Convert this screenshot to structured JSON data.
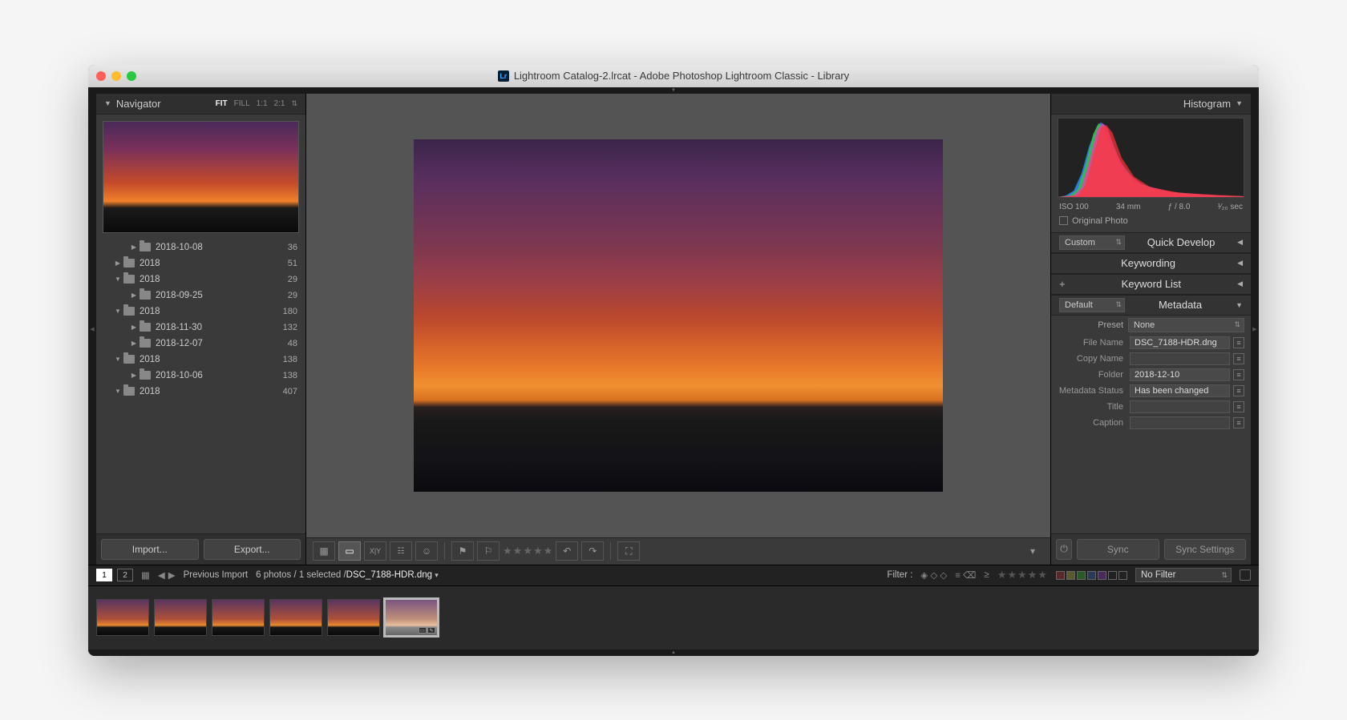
{
  "window": {
    "title": "Lightroom Catalog-2.lrcat - Adobe Photoshop Lightroom Classic - Library"
  },
  "navigator": {
    "title": "Navigator",
    "zoom": [
      "FIT",
      "FILL",
      "1:1",
      "2:1"
    ],
    "zoom_active": "FIT"
  },
  "folders": [
    {
      "indent": 2,
      "tw": "▶",
      "name": "2018-10-08",
      "count": 36
    },
    {
      "indent": 1,
      "tw": "▶",
      "name": "2018",
      "count": 51
    },
    {
      "indent": 1,
      "tw": "▼",
      "name": "2018",
      "count": 29
    },
    {
      "indent": 2,
      "tw": "▶",
      "name": "2018-09-25",
      "count": 29
    },
    {
      "indent": 1,
      "tw": "▼",
      "name": "2018",
      "count": 180
    },
    {
      "indent": 2,
      "tw": "▶",
      "name": "2018-11-30",
      "count": 132
    },
    {
      "indent": 2,
      "tw": "▶",
      "name": "2018-12-07",
      "count": 48
    },
    {
      "indent": 1,
      "tw": "▼",
      "name": "2018",
      "count": 138
    },
    {
      "indent": 2,
      "tw": "▶",
      "name": "2018-10-06",
      "count": 138
    },
    {
      "indent": 1,
      "tw": "▼",
      "name": "2018",
      "count": 407
    }
  ],
  "left_buttons": {
    "import": "Import...",
    "export": "Export..."
  },
  "histogram": {
    "title": "Histogram",
    "iso": "ISO 100",
    "focal": "34 mm",
    "aperture": "ƒ / 8.0",
    "shutter": "¹⁄₂₀ sec",
    "original_label": "Original Photo"
  },
  "quick_develop": {
    "title": "Quick Develop",
    "preset": "Custom"
  },
  "keywording": {
    "title": "Keywording"
  },
  "keyword_list": {
    "title": "Keyword List",
    "plus": "+"
  },
  "metadata": {
    "title": "Metadata",
    "set": "Default",
    "preset_label": "Preset",
    "preset": "None",
    "rows": [
      {
        "label": "File Name",
        "value": "DSC_7188-HDR.dng"
      },
      {
        "label": "Copy Name",
        "value": ""
      },
      {
        "label": "Folder",
        "value": "2018-12-10"
      },
      {
        "label": "Metadata Status",
        "value": "Has been changed"
      },
      {
        "label": "Title",
        "value": ""
      },
      {
        "label": "Caption",
        "value": ""
      }
    ]
  },
  "sync": {
    "sync": "Sync",
    "settings": "Sync Settings"
  },
  "filterbar": {
    "pages": [
      "1",
      "2"
    ],
    "source_label": "Previous Import",
    "count_text": "6 photos / 1 selected /",
    "filename": "DSC_7188-HDR.dng",
    "filter_label": "Filter :",
    "no_filter": "No Filter"
  },
  "filmstrip": {
    "count": 6,
    "selected_index": 5
  }
}
